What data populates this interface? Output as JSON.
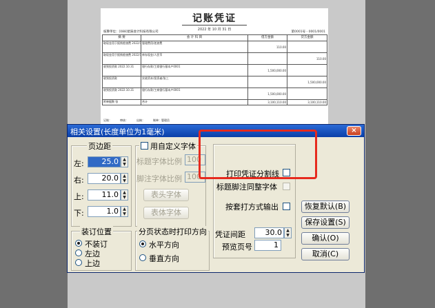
{
  "voucher": {
    "title": "记账凭证",
    "date": "2022 年 10 月 31 日",
    "unit": "核算单位：[088]星辰会计科技有限公司",
    "number": "第0001号 - 0001/0001",
    "headers": [
      "摘 要",
      "会 计 科 目",
      "借方金额",
      "贷方金额"
    ],
    "rows": [
      {
        "summary": "取现金用于报销差旅费 2022/10",
        "account": "管理费用/差旅费",
        "debit": "110.00",
        "credit": ""
      },
      {
        "summary": "取现金用于报销差旅费 2022/10",
        "account": "库存现金/人民币",
        "debit": "",
        "credit": "110.00"
      },
      {
        "summary": "收到投资款 2022.10.31",
        "account": "银行存款/工商银行基本户0001",
        "debit": "1,500,000.00",
        "credit": ""
      },
      {
        "summary": "收到投资款",
        "account": "实收资本/投资者/张三",
        "debit": "",
        "credit": "1,500,000.00"
      },
      {
        "summary": "收到投资款 2022.10.31",
        "account": "银行存款/工商银行基本户0001",
        "debit": "1,500,000.00",
        "credit": ""
      }
    ],
    "total_label": "附单据数",
    "total_count": "张",
    "total_text": "合计",
    "total_debit": "3,100,110.00",
    "total_credit": "3,100,110.00",
    "signers": "记账：　　　审核：　　　出纳：　　　制单：管理员"
  },
  "dialog": {
    "title": "相关设置(长度单位为1毫米)",
    "close": "×",
    "margins": {
      "legend": "页边距",
      "left_label": "左:",
      "left_value": "25.0",
      "right_label": "右:",
      "right_value": "20.0",
      "top_label": "上:",
      "top_value": "11.0",
      "bottom_label": "下:",
      "bottom_value": "1.0"
    },
    "custom_font": {
      "legend": "用自定义字体",
      "title_ratio_label": "标题字体比例",
      "title_ratio_value": "100",
      "footer_ratio_label": "脚注字体比例",
      "footer_ratio_value": "100",
      "header_font_button": "表头字体",
      "body_font_button": "表体字体"
    },
    "binding": {
      "legend": "装订位置",
      "options": [
        "不装订",
        "左边",
        "上边"
      ],
      "selected": "不装订"
    },
    "page_direction": {
      "legend": "分页状态时打印方向",
      "options": [
        "水平方向",
        "垂直方向"
      ],
      "selected": "水平方向"
    },
    "options": {
      "print_divider_label": "打印凭证分割线",
      "footer_font_label": "标题脚注同整字体",
      "overlay_print_label": "按套打方式输出",
      "voucher_gap_label": "凭证间距",
      "voucher_gap_value": "30.0",
      "preview_page_label": "预览页号",
      "preview_page_value": "1"
    },
    "buttons": {
      "restore": "恢复默认(B)",
      "save": "保存设置(S)",
      "ok": "确认(O)",
      "cancel": "取消(C)"
    }
  },
  "colors": {
    "highlight": "#e62a1e",
    "titlebar": "#0a3fa8",
    "dialog_bg": "#ece9d8"
  }
}
